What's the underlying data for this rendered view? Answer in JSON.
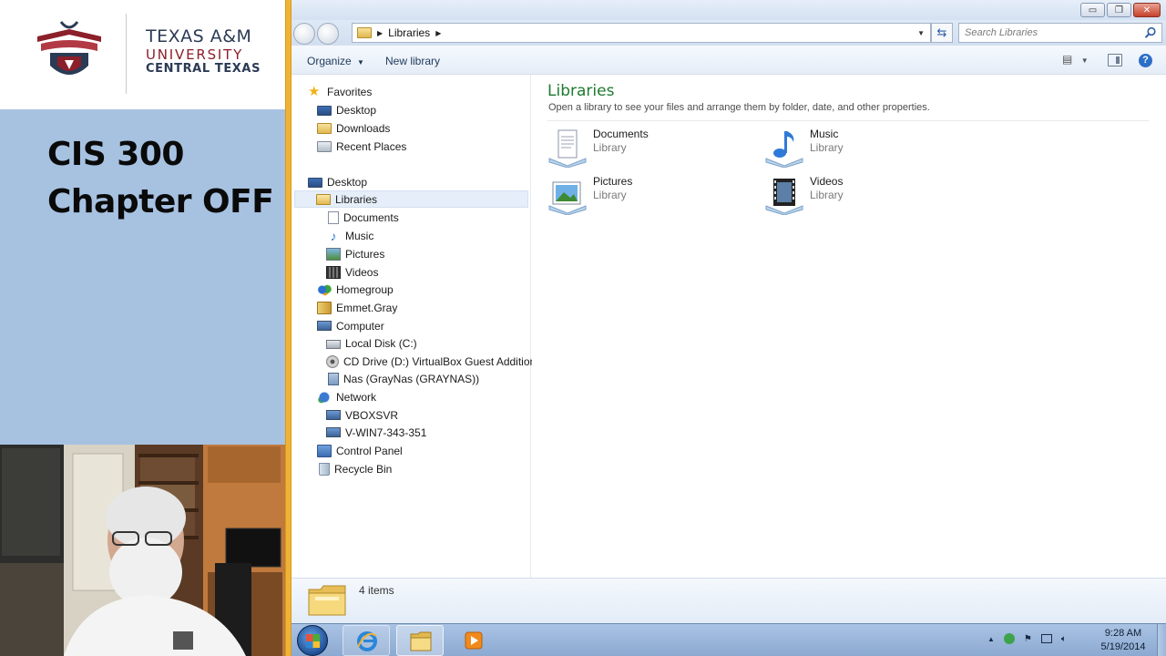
{
  "logo": {
    "line1": "TEXAS A&M",
    "line2": "UNIVERSITY",
    "line3": "CENTRAL TEXAS"
  },
  "slide": {
    "title_line1": "CIS 300",
    "title_line2": "Chapter OFF"
  },
  "window": {
    "controls": {
      "minimize": "▭",
      "restore": "❐",
      "close": "✕"
    }
  },
  "address_bar": {
    "path": [
      "Libraries"
    ],
    "search_placeholder": "Search Libraries"
  },
  "command_bar": {
    "organize": "Organize",
    "new_library": "New library",
    "help": "?"
  },
  "nav_pane": {
    "favorites": {
      "label": "Favorites",
      "icon": "star-icon"
    },
    "favorites_items": [
      {
        "label": "Desktop",
        "icon": "desktop-icon"
      },
      {
        "label": "Downloads",
        "icon": "downloads-icon"
      },
      {
        "label": "Recent Places",
        "icon": "recent-places-icon"
      }
    ],
    "desktop": {
      "label": "Desktop",
      "icon": "desktop-icon"
    },
    "libraries": {
      "label": "Libraries",
      "icon": "libraries-icon",
      "selected": true
    },
    "libraries_items": [
      {
        "label": "Documents",
        "icon": "documents-icon"
      },
      {
        "label": "Music",
        "icon": "music-icon"
      },
      {
        "label": "Pictures",
        "icon": "pictures-icon"
      },
      {
        "label": "Videos",
        "icon": "videos-icon"
      }
    ],
    "homegroup": {
      "label": "Homegroup",
      "icon": "homegroup-icon"
    },
    "user": {
      "label": "Emmet.Gray",
      "icon": "user-folder-icon"
    },
    "computer": {
      "label": "Computer",
      "icon": "computer-icon"
    },
    "computer_items": [
      {
        "label": "Local Disk (C:)",
        "icon": "hard-disk-icon"
      },
      {
        "label": "CD Drive (D:) VirtualBox Guest Additions",
        "icon": "cd-drive-icon"
      },
      {
        "label": "Nas (GrayNas (GRAYNAS))",
        "icon": "network-drive-icon"
      }
    ],
    "network": {
      "label": "Network",
      "icon": "network-icon"
    },
    "network_items": [
      {
        "label": "VBOXSVR",
        "icon": "network-computer-icon"
      },
      {
        "label": "V-WIN7-343-351",
        "icon": "network-computer-icon"
      }
    ],
    "control_panel": {
      "label": "Control Panel",
      "icon": "control-panel-icon"
    },
    "recycle_bin": {
      "label": "Recycle Bin",
      "icon": "recycle-bin-icon"
    }
  },
  "content": {
    "title": "Libraries",
    "description": "Open a library to see your files and arrange them by folder, date, and other properties.",
    "libraries": [
      {
        "name": "Documents",
        "kind": "Library",
        "icon": "documents-library-icon"
      },
      {
        "name": "Music",
        "kind": "Library",
        "icon": "music-library-icon"
      },
      {
        "name": "Pictures",
        "kind": "Library",
        "icon": "pictures-library-icon"
      },
      {
        "name": "Videos",
        "kind": "Library",
        "icon": "videos-library-icon"
      }
    ]
  },
  "details": {
    "item_count": "4 items"
  },
  "taskbar": {
    "time": "9:28 AM",
    "date": "5/19/2014",
    "tray_expand": "▲"
  },
  "colors": {
    "slide_panel": "#a7c2e1",
    "accent_bar": "#f2b233",
    "library_title": "#1e7a2f",
    "selection": "#e5eef9",
    "taskbar": "#9bb6da"
  }
}
